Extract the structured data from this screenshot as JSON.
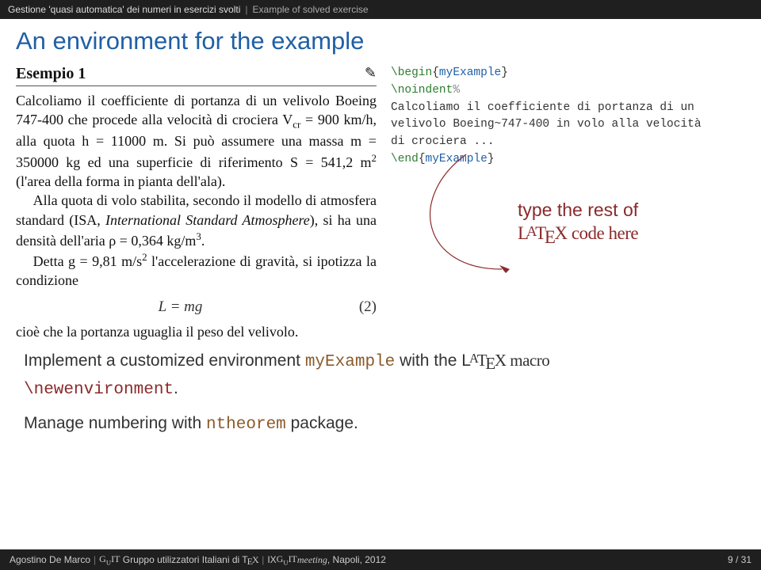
{
  "breadcrumb": {
    "part1": "Gestione 'quasi automatica' dei numeri in esercizi svolti",
    "part2": "Example of solved exercise",
    "sep": "|"
  },
  "title": "An environment for the example",
  "example": {
    "label": "Esempio 1",
    "p1": "Calcoliamo il coefficiente di portanza di un velivolo Boeing 747-400 che procede alla velocità di crociera V",
    "p1b": " = 900 km/h, alla quota h = 11000 m. Si può assumere una massa m = 350000 kg ed una superficie di riferimento S = 541,2 m",
    "p1c": " (l'area della forma in pianta dell'ala).",
    "p2": "Alla quota di volo stabilita, secondo il modello di atmosfera standard (ISA, ",
    "p2i": "International Standard Atmosphere",
    "p2b": "), si ha una densità dell'aria ρ = 0,364 kg/m",
    "p2c": ".",
    "p3": "Detta g = 9,81 m/s",
    "p3b": " l'accelerazione di gravità, si ipotizza la condizione",
    "eq": "L = mg",
    "eqnum": "(2)",
    "p4": "cioè che la portanza uguaglia il peso del velivolo."
  },
  "code": {
    "l1a": "\\begin",
    "l1b": "{",
    "l1c": "myExample",
    "l1d": "}",
    "l2a": "\\noindent",
    "l2b": "%",
    "l3": "Calcoliamo il coefficiente di portanza di un ",
    "l4": "velivolo Boeing~747-400 in volo alla velocità ",
    "l5": "di crociera ...",
    "l6a": "\\end",
    "l6b": "{",
    "l6c": "myExample",
    "l6d": "}"
  },
  "annotation": {
    "line1": "type the rest of",
    "line2": "L",
    "line2b": "T",
    "line2c": "E",
    "line2d": "X code here",
    "a": "A"
  },
  "lower": {
    "s1a": "Implement a customized environment ",
    "s1env": "myExample",
    "s1b": " with the L",
    "s1c": "T",
    "s1d": "E",
    "s1e": "X macro ",
    "s1cmd": "\\newenvironment",
    "s1f": ".",
    "s2a": "Manage numbering with ",
    "s2env": "ntheorem",
    "s2b": " package."
  },
  "footer": {
    "author": "Agostino De Marco",
    "group": "Gruppo utilizzatori Italiani di T",
    "groupE": "E",
    "groupX": "X",
    "meet": "IX ",
    "meet2": "meeting",
    "meetc": ", Napoli, 2012",
    "page": "9 / 31",
    "guit": "G",
    "guitU": "U",
    "guitIT": "IT"
  }
}
